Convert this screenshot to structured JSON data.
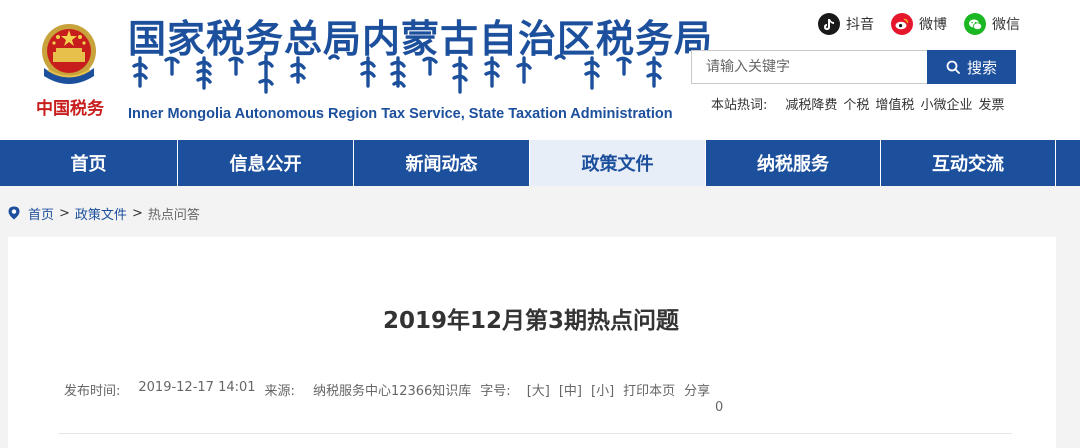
{
  "header": {
    "logo_text": "中国税务",
    "title": "国家税务总局内蒙古自治区税务局",
    "subtitle": "Inner Mongolia Autonomous Region Tax Service, State Taxation Administration",
    "mongolian_script_alt": "ᠦᠨᠳᠦᠰᠦᠨ ᠦ ᠲᠠᠲᠠᠪᠤᠷᠢ ᠶᠢᠨ ᠶᠡᠷᠦᠩᠬᠡᠢ ᠲᠣᠪᠴᠢᠶ᠎ᠠ"
  },
  "social": {
    "douyin": "抖音",
    "weibo": "微博",
    "weixin": "微信"
  },
  "search": {
    "placeholder": "请输入关键字",
    "button_label": "搜索"
  },
  "hot_words": {
    "label": "本站热词:",
    "items": [
      "减税降费",
      "个税",
      "增值税",
      "小微企业",
      "发票"
    ]
  },
  "nav": {
    "items": [
      {
        "label": "首页"
      },
      {
        "label": "信息公开"
      },
      {
        "label": "新闻动态"
      },
      {
        "label": "政策文件"
      },
      {
        "label": "纳税服务"
      },
      {
        "label": "互动交流"
      }
    ],
    "active_index": 3
  },
  "breadcrumb": {
    "home": "首页",
    "sep": ">",
    "section": "政策文件",
    "current": "热点问答"
  },
  "article": {
    "title": "2019年12月第3期热点问题",
    "meta": {
      "date_label": "发布时间:",
      "date": "2019-12-17 14:01",
      "source_label": "来源:",
      "source": "纳税服务中心12366知识库",
      "fontsize_label": "字号:",
      "size_large": "[大]",
      "size_medium": "[中]",
      "size_small": "[小]",
      "print": "打印本页",
      "share": "分享",
      "share_count": "0"
    }
  },
  "colors": {
    "brand_blue": "#1c4f9c",
    "logo_red": "#c81d1d",
    "nav_active_bg": "#e7eef8",
    "page_bg": "#f3f3f3"
  }
}
